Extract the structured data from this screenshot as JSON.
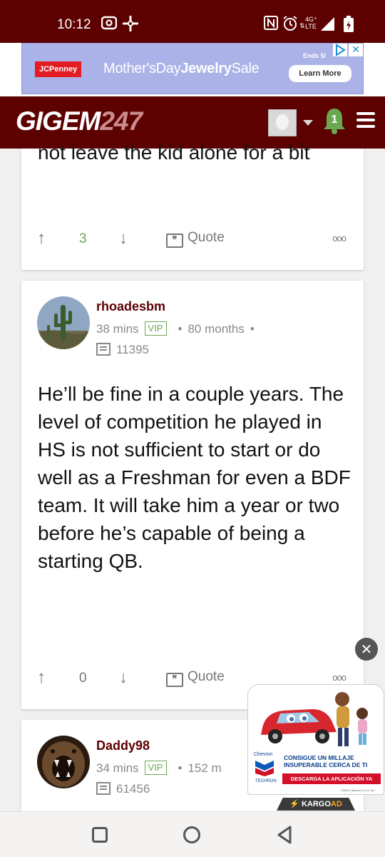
{
  "status_bar": {
    "time": "10:12",
    "network_top": "4G⁺",
    "network_bottom": "LTE"
  },
  "banner_ad": {
    "brand": "JCPenney",
    "headline_pre": "Mother'sDay",
    "headline_bold": "Jewelry",
    "headline_post": "Sale",
    "ends": "Ends 5/",
    "cta": "Learn More"
  },
  "header": {
    "logo_main": "GIGEM",
    "logo_num": "247",
    "notification_count": "1",
    "colors": {
      "brand": "#5c0000",
      "bell": "#6aa84f"
    }
  },
  "posts": [
    {
      "text": "not leave the kid alone for a bit",
      "votes": "3",
      "quote_label": "Quote",
      "more": "ooo"
    },
    {
      "username": "rhoadesbm",
      "time": "38 mins",
      "badge": "VIP",
      "tenure": "80 months",
      "post_count": "11395",
      "text": "He’ll be fine in a couple years. The level of competition he played in HS is not sufficient to start or do well as a Freshman for even a BDF team. It will take him a year or two before he’s capable of being a starting QB.",
      "votes": "0",
      "quote_label": "Quote",
      "more": "ooo"
    },
    {
      "username": "Daddy98",
      "time": "34 mins",
      "badge": "VIP",
      "tenure": "152 m",
      "post_count": "61456"
    }
  ],
  "floating_ad": {
    "sponsor": "Chevron",
    "line1": "CONSIGUE UN MILLAJE",
    "line2": "INSUPERABLE CERCA DE TI",
    "cta": "DESCARGA LA APLICACIÓN YA",
    "tech": "TECHRON",
    "legal": "©2022 Chevron U.S.A. Inc.",
    "network_pre": "⚡ KARGO",
    "network_post": "AD"
  }
}
